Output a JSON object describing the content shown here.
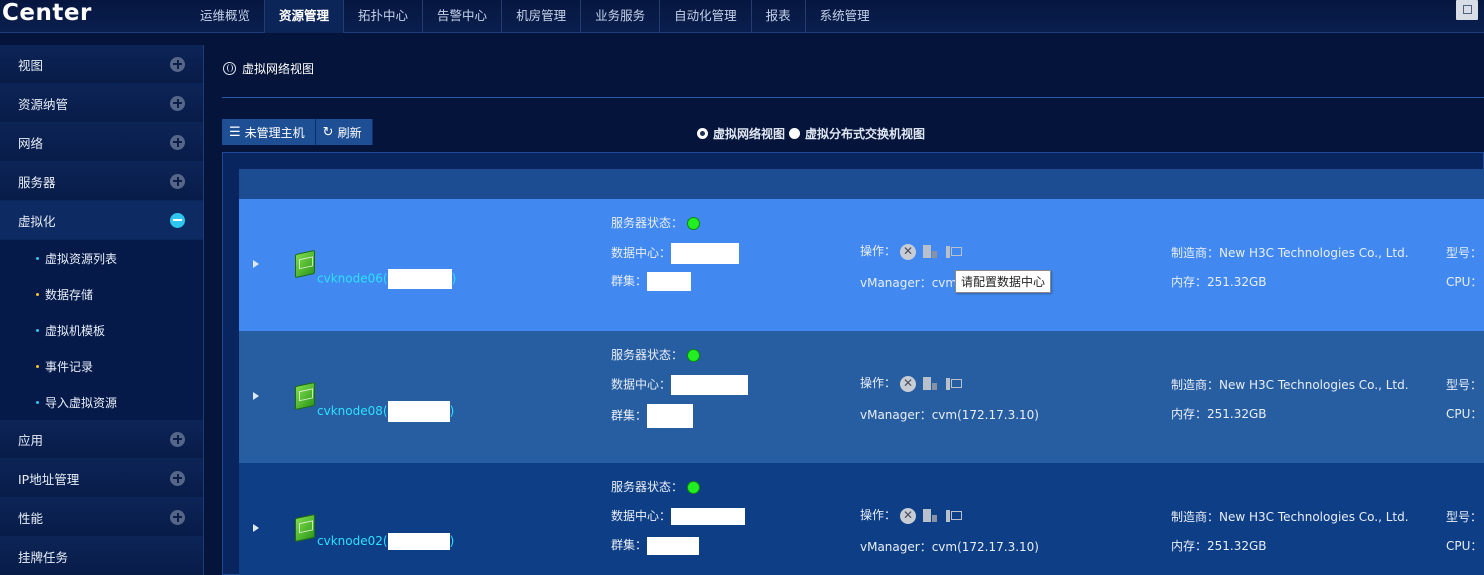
{
  "app": {
    "logo": "Center"
  },
  "topnav": {
    "items": [
      "运维概览",
      "资源管理",
      "拓扑中心",
      "告警中心",
      "机房管理",
      "业务服务",
      "自动化管理",
      "报表",
      "系统管理"
    ],
    "active": "资源管理"
  },
  "sidebar": {
    "items": [
      {
        "label": "视图"
      },
      {
        "label": "资源纳管"
      },
      {
        "label": "网络"
      },
      {
        "label": "服务器"
      },
      {
        "label": "虚拟化",
        "expanded": true,
        "children": [
          {
            "label": "虚拟资源列表",
            "dot": "#2ec6ee"
          },
          {
            "label": "数据存储",
            "dot": "#f4c430"
          },
          {
            "label": "虚拟机模板",
            "dot": "#2ec6ee"
          },
          {
            "label": "事件记录",
            "dot": "#f4c430"
          },
          {
            "label": "导入虚拟资源",
            "dot": "#2ec6ee"
          }
        ]
      },
      {
        "label": "应用"
      },
      {
        "label": "IP地址管理"
      },
      {
        "label": "性能"
      },
      {
        "label": "挂牌任务"
      }
    ]
  },
  "main": {
    "page_title": "虚拟网络视图",
    "toolbar": {
      "unmanaged": "未管理主机",
      "refresh": "刷新"
    },
    "view_options": [
      {
        "label": "虚拟网络视图",
        "checked": true
      },
      {
        "label": "虚拟分布式交换机视图",
        "checked": false
      }
    ],
    "labels": {
      "status": "服务器状态：",
      "datacenter": "数据中心：",
      "cluster": "群集：",
      "ops": "操作：",
      "vmanager": "vManager：",
      "maker": "制造商：",
      "memory": "内存：",
      "model": "型号：",
      "cpu": "CPU："
    },
    "hosts": [
      {
        "name": "cvknode06",
        "bracket_open": "(",
        "bracket_close": ")",
        "vmanager": "cvm(",
        "maker": "New H3C Technologies Co., Ltd.",
        "memory": "251.32GB",
        "bg": "#4189f0"
      },
      {
        "name": "cvknode08",
        "bracket_open": "(",
        "bracket_close": ")",
        "vmanager": "cvm(172.17.3.10)",
        "maker": "New H3C Technologies Co., Ltd.",
        "memory": "251.32GB",
        "bg": "#275ea2"
      },
      {
        "name": "cvknode02",
        "bracket_open": "(",
        "bracket_close": ")",
        "vmanager": "cvm(172.17.3.10)",
        "maker": "New H3C Technologies Co., Ltd.",
        "memory": "251.32GB",
        "bg": "#0e3e85"
      }
    ],
    "tooltip": "请配置数据中心",
    "colors": {
      "status_ok": "#22ee22",
      "hostname": "#2ee0ff"
    }
  }
}
